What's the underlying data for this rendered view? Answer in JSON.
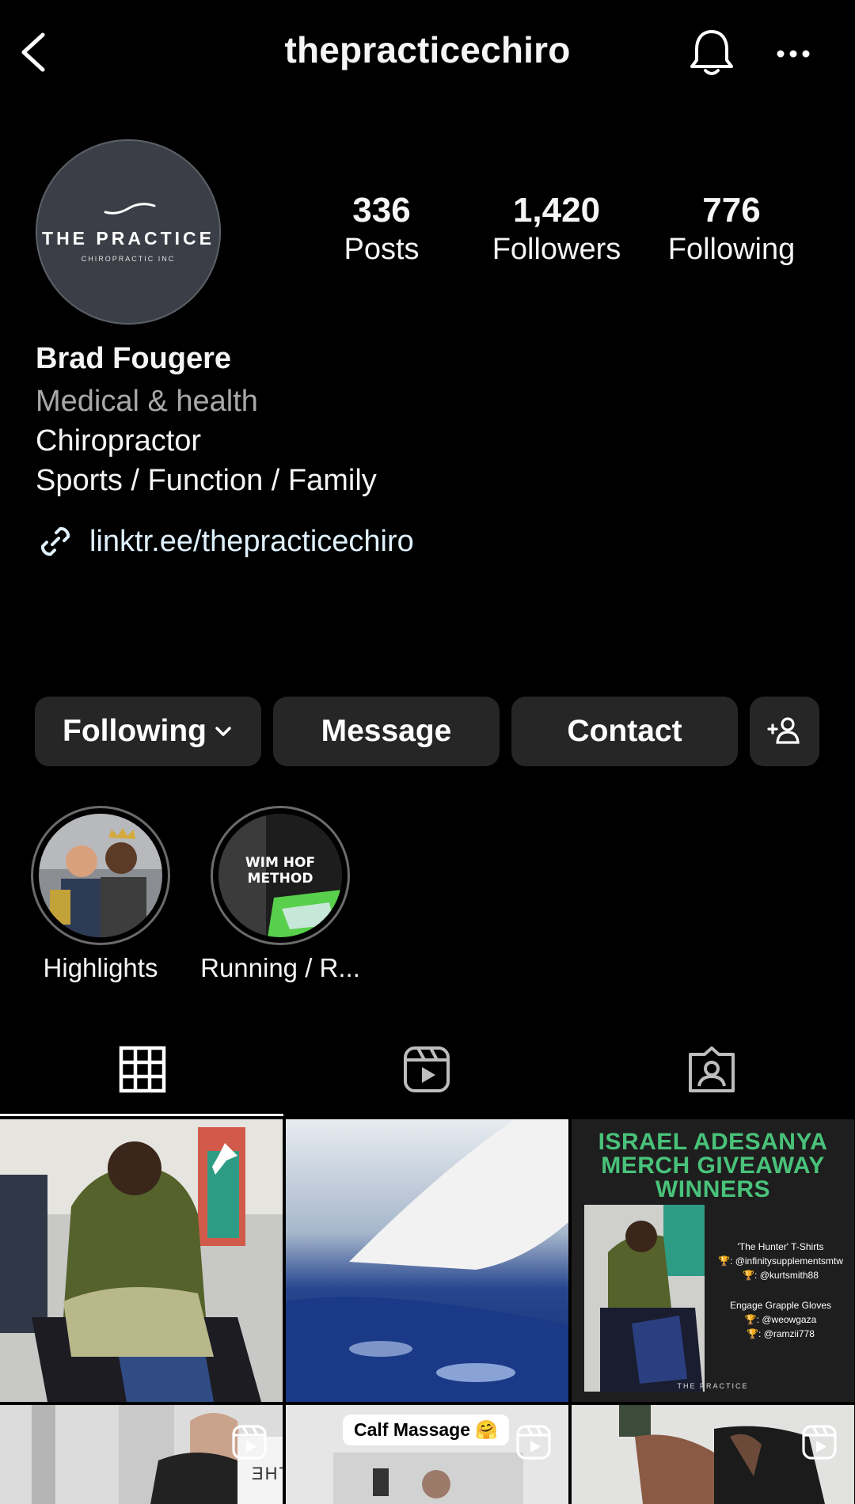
{
  "header": {
    "username": "thepracticechiro"
  },
  "profile": {
    "avatar_brand": "THE PRACTICE",
    "avatar_sub": "CHIROPRACTIC INC",
    "stats": [
      {
        "value": "336",
        "label": "Posts"
      },
      {
        "value": "1,420",
        "label": "Followers"
      },
      {
        "value": "776",
        "label": "Following"
      }
    ],
    "name": "Brad Fougere",
    "category": "Medical & health",
    "bio_lines": [
      "Chiropractor",
      "Sports / Function / Family"
    ],
    "link": "linktr.ee/thepracticechiro"
  },
  "actions": {
    "following_label": "Following",
    "message_label": "Message",
    "contact_label": "Contact"
  },
  "highlights": [
    {
      "label": "Highlights"
    },
    {
      "label": "Running / R...",
      "cover_text": "WIM HOF METHOD"
    }
  ],
  "tabs": [
    "grid",
    "reels",
    "tagged"
  ],
  "grid": {
    "giveaway": {
      "title_lines": [
        "ISRAEL ADESANYA",
        "MERCH GIVEAWAY",
        "WINNERS"
      ],
      "lines": [
        "'The Hunter' T-Shirts",
        "🏆: @infinitysupplementsmtw",
        "🏆: @kurtsmith88",
        "Engage Grapple Gloves",
        "🏆: @weowgaza",
        "🏆: @ramzii778"
      ],
      "footer": "THE PRACTICE"
    },
    "calf_caption": "Calf Massage 🤗",
    "partial_text": "THE I"
  },
  "colors": {
    "background": "#000000",
    "button": "#262626",
    "link": "#e0f1ff",
    "muted": "#a8a8a8",
    "giveaway_green": "#49c27a"
  }
}
